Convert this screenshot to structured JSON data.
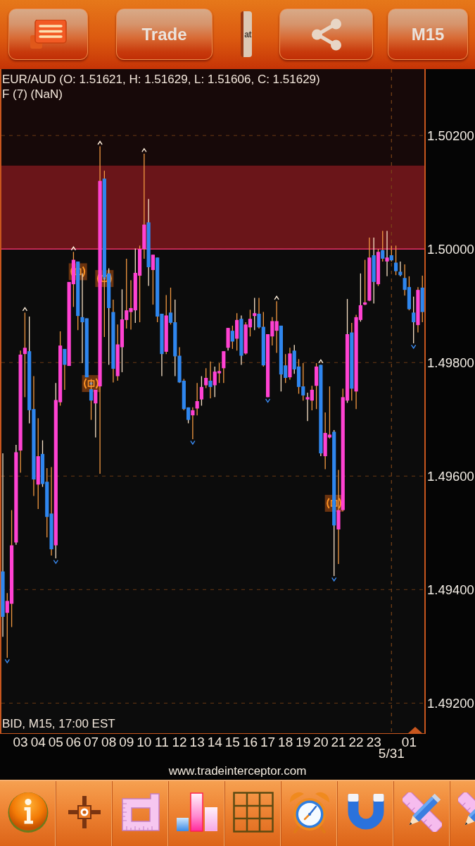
{
  "top_bar": {
    "buttons": [
      {
        "kind": "menu"
      },
      {
        "kind": "action",
        "label": "Trade"
      },
      {
        "kind": "cut",
        "label": "at"
      },
      {
        "kind": "share"
      },
      {
        "kind": "timeframe",
        "label": "M15"
      }
    ]
  },
  "chart": {
    "chart_data": {
      "type": "candlestick",
      "title": "EUR/AUD (O: 1.51621, H: 1.51629, L: 1.51606, C: 1.51629)",
      "x": [
        2,
        2.25,
        2.5,
        2.75,
        3,
        3.25,
        3.5,
        3.75,
        4,
        4.25,
        4.5,
        4.75,
        5,
        5.25,
        5.5,
        5.75,
        6,
        6.25,
        6.5,
        6.75,
        7,
        7.25,
        7.5,
        7.75,
        8,
        8.25,
        8.5,
        8.75,
        9,
        9.25,
        9.5,
        9.75,
        10,
        10.25,
        10.5,
        10.75,
        11,
        11.25,
        11.5,
        11.75,
        12,
        12.25,
        12.5,
        12.75,
        13,
        13.25,
        13.5,
        13.75,
        14,
        14.25,
        14.5,
        14.75,
        15,
        15.25,
        15.5,
        15.75,
        16,
        16.25,
        16.5,
        16.75,
        17,
        17.25,
        17.5,
        17.75,
        18,
        18.25,
        18.5,
        18.75,
        19,
        19.25,
        19.5,
        19.75,
        20,
        20.25,
        20.5,
        20.75,
        21,
        21.25,
        21.5,
        21.75,
        22,
        22.25,
        22.5,
        22.75,
        23,
        23.25,
        23.5,
        23.75,
        24,
        24.25,
        24.5,
        24.75,
        25,
        25.25,
        25.5,
        25.75
      ],
      "ohlc": [
        [
          1.49432,
          1.4964,
          1.49317,
          1.49352
        ],
        [
          1.49359,
          1.49394,
          1.4928,
          1.4938
        ],
        [
          1.49375,
          1.4954,
          1.49334,
          1.49478
        ],
        [
          1.49483,
          1.49655,
          1.49479,
          1.49642
        ],
        [
          1.49645,
          1.49821,
          1.49606,
          1.49814
        ],
        [
          1.49815,
          1.49888,
          1.49739,
          1.49826
        ],
        [
          1.4982,
          1.49881,
          1.49693,
          1.49716
        ],
        [
          1.49718,
          1.49776,
          1.49565,
          1.49594
        ],
        [
          1.49585,
          1.49702,
          1.49542,
          1.49635
        ],
        [
          1.49639,
          1.49663,
          1.49581,
          1.49586
        ],
        [
          1.4959,
          1.49614,
          1.49492,
          1.49528
        ],
        [
          1.49534,
          1.49616,
          1.4946,
          1.49471
        ],
        [
          1.49478,
          1.49764,
          1.49455,
          1.49734
        ],
        [
          1.4973,
          1.49855,
          1.49724,
          1.4983
        ],
        [
          1.49824,
          1.49824,
          1.49752,
          1.49796
        ],
        [
          1.49794,
          1.49942,
          1.49794,
          1.49942
        ],
        [
          1.49938,
          1.49995,
          1.49898,
          1.49981
        ],
        [
          1.49978,
          1.49978,
          1.49857,
          1.49882
        ],
        [
          1.4988,
          1.49957,
          1.49799,
          1.49871
        ],
        [
          1.49878,
          1.49878,
          1.49774,
          1.49774
        ],
        [
          1.49753,
          1.49771,
          1.49699,
          1.49733
        ],
        [
          1.49728,
          1.49752,
          1.49668,
          1.49752
        ],
        [
          1.49758,
          1.50181,
          1.49604,
          1.5012
        ],
        [
          1.50124,
          1.50138,
          1.49845,
          1.4995
        ],
        [
          1.49957,
          1.49966,
          1.49796,
          1.49896
        ],
        [
          1.49889,
          1.49911,
          1.49765,
          1.49789
        ],
        [
          1.49776,
          1.49867,
          1.49768,
          1.49832
        ],
        [
          1.49827,
          1.49929,
          1.49783,
          1.49876
        ],
        [
          1.49875,
          1.49983,
          1.4986,
          1.49892
        ],
        [
          1.49889,
          1.49945,
          1.49858,
          1.49896
        ],
        [
          1.49892,
          1.50001,
          1.4987,
          1.49958
        ],
        [
          1.49953,
          1.50006,
          1.49871,
          1.5
        ],
        [
          1.5,
          1.50168,
          1.49983,
          1.50043
        ],
        [
          1.50047,
          1.50088,
          1.49935,
          1.49968
        ],
        [
          1.49963,
          1.4999,
          1.49902,
          1.4999
        ],
        [
          1.49985,
          1.49985,
          1.49871,
          1.49881
        ],
        [
          1.49886,
          1.49886,
          1.49776,
          1.49815
        ],
        [
          1.49819,
          1.49919,
          1.49815,
          1.49883
        ],
        [
          1.49888,
          1.49932,
          1.49867,
          1.4987
        ],
        [
          1.49871,
          1.49911,
          1.49776,
          1.49811
        ],
        [
          1.49812,
          1.49827,
          1.49764,
          1.49765
        ],
        [
          1.49768,
          1.49771,
          1.49716,
          1.49718
        ],
        [
          1.49721,
          1.49721,
          1.49693,
          1.49699
        ],
        [
          1.49707,
          1.49721,
          1.49665,
          1.49716
        ],
        [
          1.49719,
          1.49764,
          1.49707,
          1.49732
        ],
        [
          1.49735,
          1.49776,
          1.49724,
          1.49757
        ],
        [
          1.4976,
          1.4979,
          1.49755,
          1.49773
        ],
        [
          1.49768,
          1.49802,
          1.49737,
          1.49757
        ],
        [
          1.4976,
          1.49793,
          1.49739,
          1.49784
        ],
        [
          1.49781,
          1.49799,
          1.49764,
          1.49785
        ],
        [
          1.4979,
          1.4982,
          1.49764,
          1.4982
        ],
        [
          1.49826,
          1.49861,
          1.49821,
          1.49861
        ],
        [
          1.49856,
          1.49865,
          1.49824,
          1.49837
        ],
        [
          1.49842,
          1.49887,
          1.49821,
          1.49875
        ],
        [
          1.49877,
          1.49883,
          1.49796,
          1.49812
        ],
        [
          1.49816,
          1.49871,
          1.49814,
          1.49867
        ],
        [
          1.49862,
          1.49893,
          1.49846,
          1.49877
        ],
        [
          1.49882,
          1.49914,
          1.49857,
          1.49887
        ],
        [
          1.49886,
          1.49914,
          1.4986,
          1.49862
        ],
        [
          1.49863,
          1.49889,
          1.49793,
          1.49795
        ],
        [
          1.49739,
          1.4985,
          1.49739,
          1.4985
        ],
        [
          1.49846,
          1.4988,
          1.4983,
          1.49873
        ],
        [
          1.49856,
          1.49908,
          1.49817,
          1.49873
        ],
        [
          1.49865,
          1.49865,
          1.49749,
          1.49779
        ],
        [
          1.49795,
          1.49815,
          1.49764,
          1.49773
        ],
        [
          1.49774,
          1.49826,
          1.4977,
          1.49816
        ],
        [
          1.49821,
          1.49831,
          1.4978,
          1.49788
        ],
        [
          1.49793,
          1.49806,
          1.49745,
          1.49757
        ],
        [
          1.49758,
          1.49799,
          1.49733,
          1.49742
        ],
        [
          1.49735,
          1.49747,
          1.49697,
          1.49739
        ],
        [
          1.49733,
          1.49759,
          1.49716,
          1.49752
        ],
        [
          1.49759,
          1.49799,
          1.49718,
          1.49793
        ],
        [
          1.49796,
          1.49796,
          1.49635,
          1.4964
        ],
        [
          1.49635,
          1.49712,
          1.49612,
          1.49676
        ],
        [
          1.49668,
          1.49758,
          1.49666,
          1.49673
        ],
        [
          1.49678,
          1.49681,
          1.49424,
          1.49513
        ],
        [
          1.49506,
          1.49611,
          1.49445,
          1.4954
        ],
        [
          1.4954,
          1.49754,
          1.49538,
          1.49739
        ],
        [
          1.49733,
          1.49912,
          1.49729,
          1.4985
        ],
        [
          1.49853,
          1.4987,
          1.49733,
          1.49754
        ],
        [
          1.49749,
          1.49884,
          1.49718,
          1.4988
        ],
        [
          1.49875,
          1.49957,
          1.49872,
          1.49901
        ],
        [
          1.49902,
          1.49981,
          1.49901,
          1.49906
        ],
        [
          1.49909,
          1.5002,
          1.49908,
          1.49985
        ],
        [
          1.49989,
          1.5002,
          1.49904,
          1.49942
        ],
        [
          1.49938,
          1.5,
          1.49935,
          1.49995
        ],
        [
          1.49998,
          1.50032,
          1.49978,
          1.49983
        ],
        [
          1.49978,
          1.50032,
          1.49952,
          1.49985
        ],
        [
          1.49989,
          1.50006,
          1.49978,
          1.4998
        ],
        [
          1.49976,
          1.50006,
          1.49954,
          1.49961
        ],
        [
          1.4996,
          1.49978,
          1.49952,
          1.49954
        ],
        [
          1.49949,
          1.49973,
          1.49918,
          1.49928
        ],
        [
          1.49933,
          1.49952,
          1.49892,
          1.49894
        ],
        [
          1.49888,
          1.49916,
          1.49834,
          1.49871
        ],
        [
          1.49866,
          1.49933,
          1.49853,
          1.49928
        ],
        [
          1.49932,
          1.49953,
          1.49871,
          1.49889
        ]
      ],
      "xlim": [
        1.92,
        25.86
      ],
      "ylim": [
        1.49147,
        1.50317
      ],
      "xticks": [
        {
          "value": 3,
          "label": "03"
        },
        {
          "value": 4,
          "label": "04"
        },
        {
          "value": 5,
          "label": "05"
        },
        {
          "value": 6,
          "label": "06"
        },
        {
          "value": 7,
          "label": "07"
        },
        {
          "value": 8,
          "label": "08"
        },
        {
          "value": 9,
          "label": "09"
        },
        {
          "value": 10,
          "label": "10"
        },
        {
          "value": 11,
          "label": "11"
        },
        {
          "value": 12,
          "label": "12"
        },
        {
          "value": 13,
          "label": "13"
        },
        {
          "value": 14,
          "label": "14"
        },
        {
          "value": 15,
          "label": "15"
        },
        {
          "value": 16,
          "label": "16"
        },
        {
          "value": 17,
          "label": "17"
        },
        {
          "value": 18,
          "label": "18"
        },
        {
          "value": 19,
          "label": "19"
        },
        {
          "value": 20,
          "label": "20"
        },
        {
          "value": 21,
          "label": "21"
        },
        {
          "value": 22,
          "label": "22"
        },
        {
          "value": 23,
          "label": "23"
        }
      ],
      "yticks": [
        {
          "value": 1.502,
          "label": "1.50200"
        },
        {
          "value": 1.5,
          "label": "1.50000"
        },
        {
          "value": 1.498,
          "label": "1.49800"
        },
        {
          "value": 1.496,
          "label": "1.49600"
        },
        {
          "value": 1.494,
          "label": "1.49400"
        },
        {
          "value": 1.492,
          "label": "1.49200"
        }
      ],
      "grid": true,
      "bands": [
        {
          "axis": "y",
          "from": 1.50147,
          "to": 1.50317,
          "color": "#170909"
        },
        {
          "axis": "y",
          "from": 1.5,
          "to": 1.50147,
          "color": "#6a1519"
        }
      ],
      "ref_lines": [
        {
          "axis": "y",
          "value": 1.5
        },
        {
          "axis": "x",
          "value": 24
        }
      ]
    },
    "next_day": {
      "date": "5/31",
      "hour": "01"
    },
    "indicator": "F (7) (NaN)",
    "footer": "BID, M15, 17:00 EST"
  },
  "website": "www.tradeinterceptor.com",
  "tool_bar": {
    "buttons": [
      {
        "kind": "info"
      },
      {
        "kind": "crosshair"
      },
      {
        "kind": "ruler"
      },
      {
        "kind": "bars"
      },
      {
        "kind": "grid"
      },
      {
        "kind": "alarm"
      },
      {
        "kind": "magnet"
      },
      {
        "kind": "draw"
      },
      {
        "kind": "draw_cut"
      }
    ]
  }
}
